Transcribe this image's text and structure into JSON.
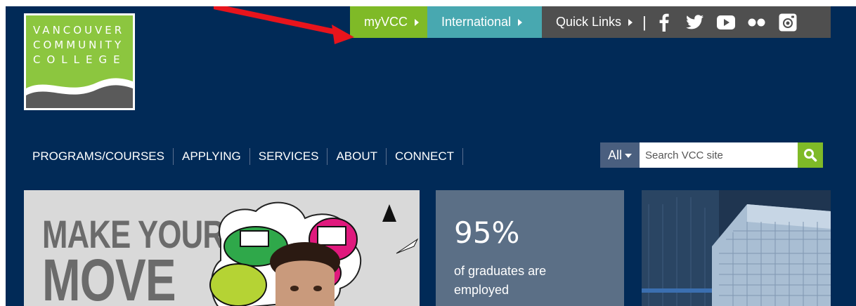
{
  "logo": {
    "lines": [
      "VANCOUVER",
      "COMMUNITY",
      "COLLEGE"
    ]
  },
  "utility": {
    "myvcc": "myVCC",
    "international": "International",
    "quick_links": "Quick Links",
    "separator": "|",
    "social": [
      "facebook-icon",
      "twitter-icon",
      "youtube-icon",
      "flickr-icon",
      "instagram-icon"
    ]
  },
  "nav": {
    "items": [
      "PROGRAMS/COURSES",
      "APPLYING",
      "SERVICES",
      "ABOUT",
      "CONNECT"
    ]
  },
  "search": {
    "scope": "All",
    "placeholder": "Search VCC site"
  },
  "hero": {
    "line1": "MAKE YOUR",
    "line2": "MOVE"
  },
  "stat": {
    "number": "95%",
    "caption": "of graduates are employed"
  },
  "colors": {
    "background": "#012a57",
    "brand_green": "#8cc63f",
    "myvcc": "#7fba27",
    "international": "#48a8b0",
    "quick_links": "#4f4f4f",
    "annotation_arrow": "#e8141c"
  }
}
